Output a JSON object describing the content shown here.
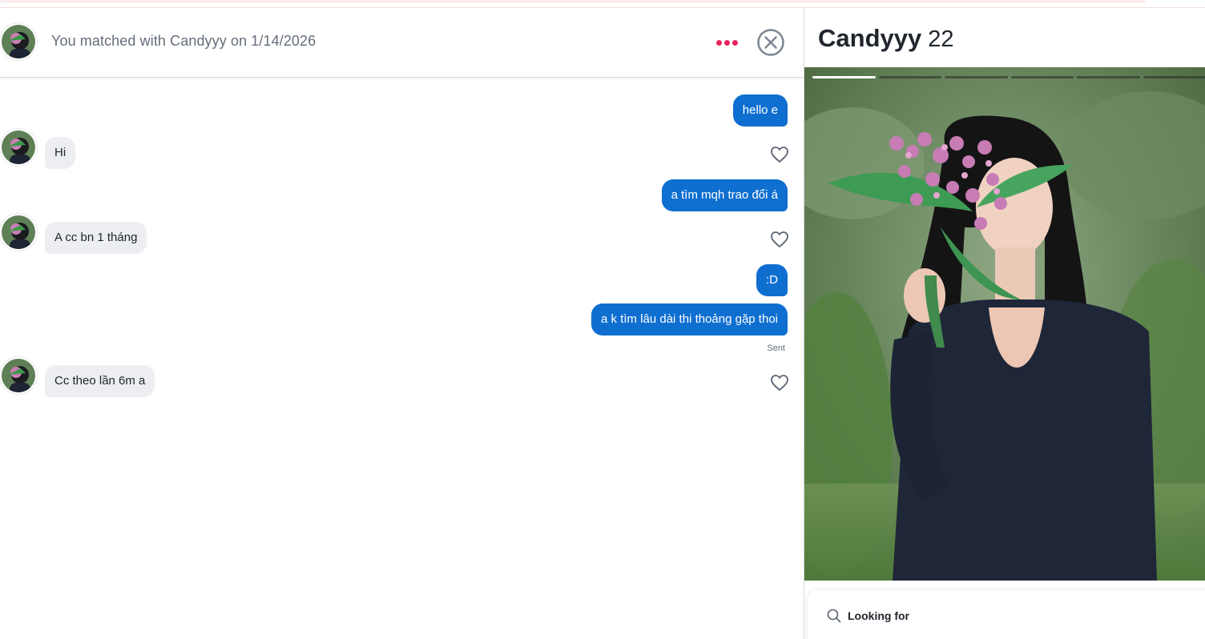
{
  "header": {
    "match_text": "You matched with Candyyy on 1/14/2026",
    "more_icon": "more-dots-icon",
    "close_icon": "close-circle-icon"
  },
  "messages": [
    {
      "direction": "out",
      "text": "hello e"
    },
    {
      "direction": "in",
      "text": "Hi"
    },
    {
      "direction": "out",
      "text": "a tìm mqh trao đổi á"
    },
    {
      "direction": "in",
      "text": "A cc bn 1 tháng"
    },
    {
      "direction": "out",
      "text": ":D"
    },
    {
      "direction": "out",
      "text": "a k tìm lâu dài thi thoảng gặp thoi"
    },
    {
      "direction": "in",
      "text": "Cc theo lần 6m a"
    }
  ],
  "sent_label": "Sent",
  "profile": {
    "name": "Candyyy",
    "age": "22",
    "photo_count": 6,
    "active_photo": 1,
    "looking_for_label": "Looking for"
  },
  "colors": {
    "outgoing_bubble": "#0f6fd1",
    "incoming_bubble": "#eceef2",
    "accent_dots": "#e8265e"
  }
}
